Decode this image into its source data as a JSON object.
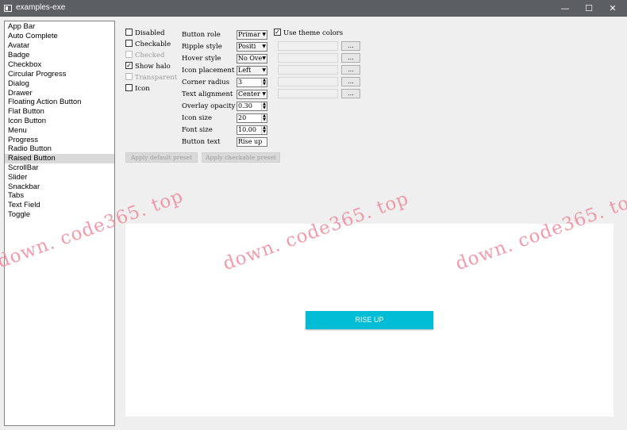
{
  "window": {
    "title": "examples-exe",
    "controls": {
      "minimize": "—",
      "maximize": "☐",
      "close": "✕"
    }
  },
  "sidebar": {
    "selected": "Raised Button",
    "items": [
      "App Bar",
      "Auto Complete",
      "Avatar",
      "Badge",
      "Checkbox",
      "Circular Progress",
      "Dialog",
      "Drawer",
      "Floating Action Button",
      "Flat Button",
      "Icon Button",
      "Menu",
      "Progress",
      "Radio Button",
      "Raised Button",
      "ScrollBar",
      "Slider",
      "Snackbar",
      "Tabs",
      "Text Field",
      "Toggle"
    ]
  },
  "options": {
    "disabled": {
      "label": "Disabled",
      "checked": false,
      "enabled": true
    },
    "checkable": {
      "label": "Checkable",
      "checked": false,
      "enabled": true
    },
    "checked": {
      "label": "Checked",
      "checked": false,
      "enabled": false
    },
    "show_halo": {
      "label": "Show halo",
      "checked": true,
      "enabled": true
    },
    "transparent": {
      "label": "Transparent",
      "checked": false,
      "enabled": false
    },
    "icon": {
      "label": "Icon",
      "checked": false,
      "enabled": true
    }
  },
  "form": {
    "button_role": {
      "label": "Button role",
      "value": "Primar"
    },
    "ripple_style": {
      "label": "Ripple style",
      "value": "Positi"
    },
    "hover_style": {
      "label": "Hover style",
      "value": "No Ove"
    },
    "icon_placement": {
      "label": "Icon placement",
      "value": "Left"
    },
    "corner_radius": {
      "label": "Corner radius",
      "value": "3"
    },
    "text_alignment": {
      "label": "Text alignment",
      "value": "Center"
    },
    "overlay_opacity": {
      "label": "Overlay opacity",
      "value": "0.30"
    },
    "icon_size": {
      "label": "Icon size",
      "value": "20"
    },
    "font_size": {
      "label": "Font size",
      "value": "10.00"
    },
    "button_text": {
      "label": "Button text",
      "value": "Rise up"
    }
  },
  "colors": {
    "use_theme_colors": {
      "label": "Use theme colors",
      "checked": true
    },
    "pick_label": "..."
  },
  "presets": {
    "apply_default": "Apply default preset",
    "apply_checkable": "Apply checkable preset"
  },
  "preview": {
    "button_label": "RISE UP",
    "button_color": "#00bcd4"
  },
  "watermark": "down. code365. top"
}
